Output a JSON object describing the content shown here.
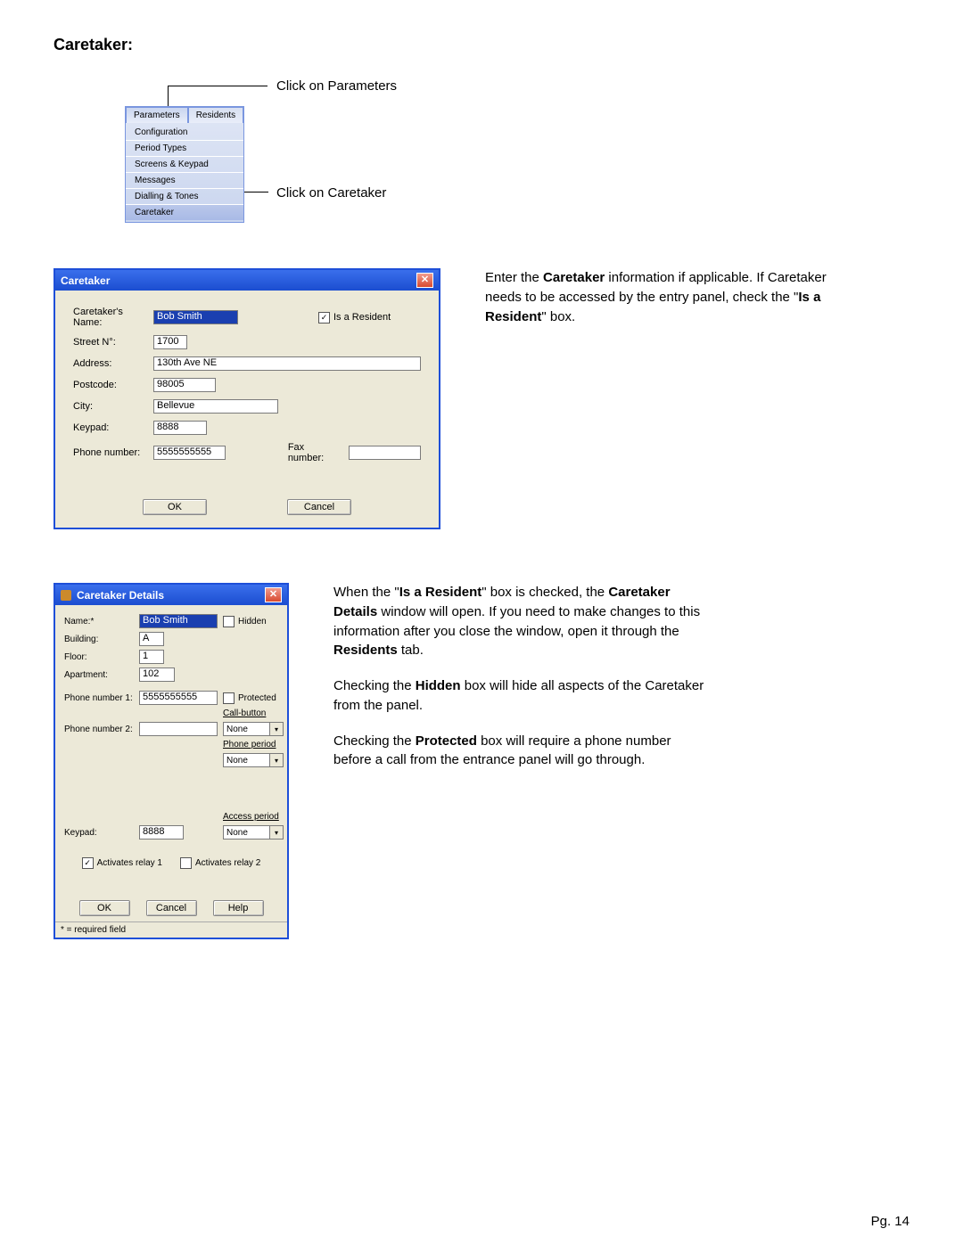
{
  "section_title": "Caretaker:",
  "menu_fig": {
    "callout_top": "Click on Parameters",
    "callout_bot": "Click on Caretaker",
    "tabs": [
      "Parameters",
      "Residents"
    ],
    "items": [
      "Configuration",
      "Period Types",
      "Screens & Keypad",
      "Messages",
      "Dialling & Tones",
      "Caretaker"
    ]
  },
  "dlg1": {
    "title": "Caretaker",
    "labels": {
      "name": "Caretaker's Name:",
      "street": "Street N°:",
      "address": "Address:",
      "postcode": "Postcode:",
      "city": "City:",
      "keypad": "Keypad:",
      "phone": "Phone number:",
      "fax": "Fax number:",
      "resident": "Is a Resident"
    },
    "values": {
      "name": "Bob Smith",
      "street": "1700",
      "address": "130th Ave NE",
      "postcode": "98005",
      "city": "Bellevue",
      "keypad": "8888",
      "phone": "5555555555",
      "fax": ""
    },
    "buttons": {
      "ok": "OK",
      "cancel": "Cancel"
    }
  },
  "dlg1_text": {
    "p1a": "Enter the ",
    "p1b": "Caretaker",
    "p1c": " information if applicable.  If Caretaker needs to be accessed by the entry panel, check the \"",
    "p1d": "Is a Resident",
    "p1e": "\" box."
  },
  "dlg2": {
    "title": "Caretaker Details",
    "labels": {
      "name": "Name:*",
      "building": "Building:",
      "floor": "Floor:",
      "apartment": "Apartment:",
      "phone1": "Phone number 1:",
      "phone2": "Phone number 2:",
      "keypad": "Keypad:",
      "hidden": "Hidden",
      "protected": "Protected",
      "callbutton": "Call-button",
      "phoneperiod": "Phone period",
      "accessperiod": "Access period",
      "relay1": "Activates relay 1",
      "relay2": "Activates relay 2"
    },
    "values": {
      "name": "Bob Smith",
      "building": "A",
      "floor": "1",
      "apartment": "102",
      "phone1": "5555555555",
      "phone2": "",
      "keypad": "8888",
      "callbutton": "None",
      "phoneperiod": "None",
      "accessperiod": "None"
    },
    "buttons": {
      "ok": "OK",
      "cancel": "Cancel",
      "help": "Help"
    },
    "footnote": "* = required field"
  },
  "dlg2_text": {
    "p1a": "When the \"",
    "p1b": "Is a Resident",
    "p1c": "\" box is checked, the ",
    "p1d": "Caretaker Details",
    "p1e": " window will open.  If you need to make changes to this information after you close the window, open it through the ",
    "p1f": "Residents",
    "p1g": " tab.",
    "p2a": "Checking the ",
    "p2b": "Hidden",
    "p2c": " box will hide all aspects of the Caretaker from the panel.",
    "p3a": "Checking the ",
    "p3b": "Protected",
    "p3c": " box will require a phone number before a call from the entrance panel will go through."
  },
  "footer": "Pg. 14"
}
